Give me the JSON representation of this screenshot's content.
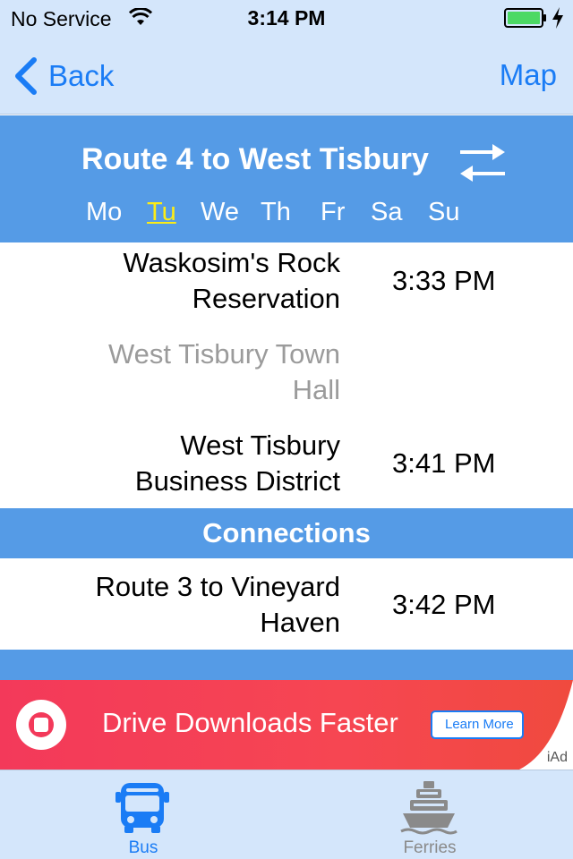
{
  "status_bar": {
    "carrier": "No Service",
    "time": "3:14 PM",
    "battery_color": "#4cd964"
  },
  "nav": {
    "back_label": "Back",
    "map_label": "Map"
  },
  "route": {
    "title": "Route 4 to West Tisbury",
    "days": [
      "Mo",
      "Tu",
      "We",
      "Th",
      "Fr",
      "Sa",
      "Su"
    ],
    "selected_day": "Tu"
  },
  "stops": [
    {
      "name_line1": "Waskosim's Rock",
      "name_line2": "Reservation",
      "time": "3:33 PM",
      "dimmed": false
    },
    {
      "name_line1": "West Tisbury Town",
      "name_line2": "Hall",
      "time": "",
      "dimmed": true
    },
    {
      "name_line1": "West Tisbury",
      "name_line2": "Business District",
      "time": "3:41 PM",
      "dimmed": false
    }
  ],
  "connections": {
    "title": "Connections",
    "items": [
      {
        "name_line1": "Route 3 to Vineyard",
        "name_line2": "Haven",
        "time": "3:42 PM"
      }
    ]
  },
  "ad": {
    "headline": "Drive Downloads Faster",
    "button_label": "Learn More",
    "badge": "iAd"
  },
  "tabs": [
    {
      "label": "Bus",
      "icon": "bus-icon",
      "active": true
    },
    {
      "label": "Ferries",
      "icon": "ferry-icon",
      "active": false
    }
  ],
  "colors": {
    "accent": "#1a7cf5",
    "header_blue": "#559be6",
    "chrome": "#d4e6fb",
    "selected_day": "#fcec16",
    "dimmed_text": "#9b9b9b"
  }
}
